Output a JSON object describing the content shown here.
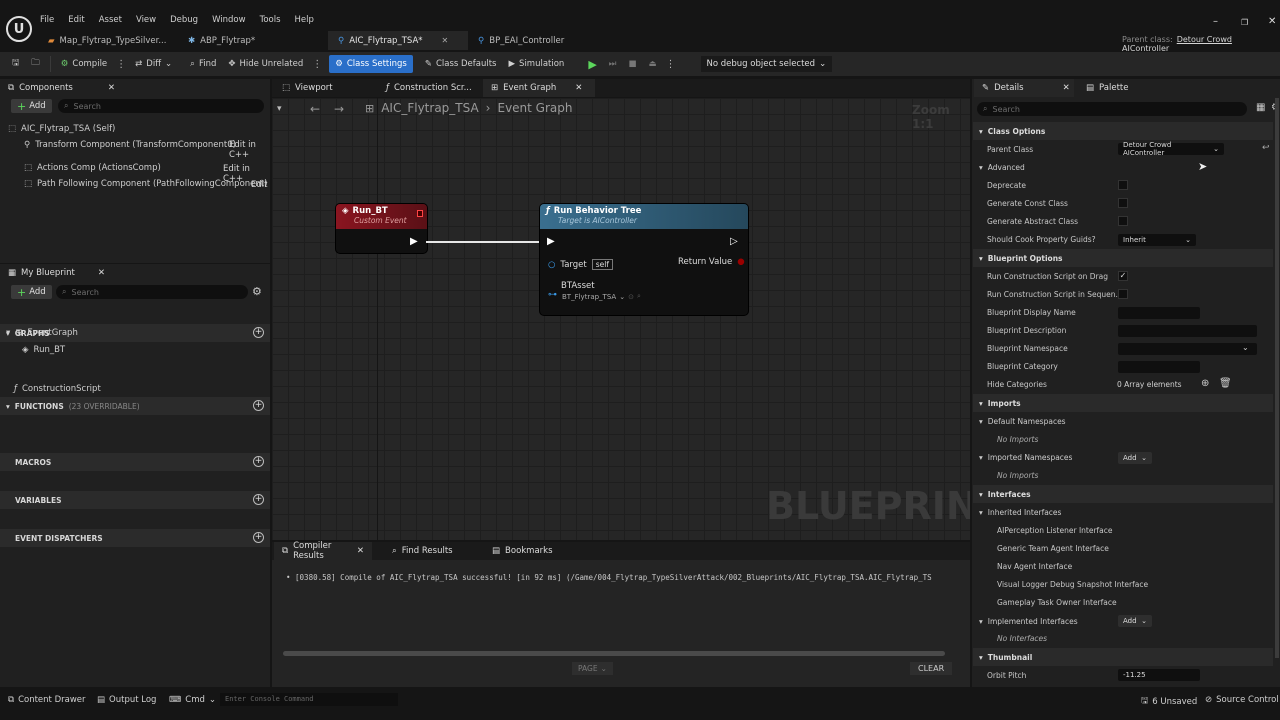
{
  "menu": [
    "File",
    "Edit",
    "Asset",
    "View",
    "Debug",
    "Window",
    "Tools",
    "Help"
  ],
  "doc_tabs": [
    {
      "label": "Map_Flytrap_TypeSilver..."
    },
    {
      "label": "ABP_Flytrap*"
    },
    {
      "label": "AIC_Flytrap_TSA*"
    },
    {
      "label": "BP_EAI_Controller"
    }
  ],
  "parent_class": {
    "label": "Parent class:",
    "value": "Detour Crowd AIController"
  },
  "toolbar": {
    "compile": "Compile",
    "diff": "Diff",
    "find": "Find",
    "hide_unrelated": "Hide Unrelated",
    "class_settings": "Class Settings",
    "class_defaults": "Class Defaults",
    "simulation": "Simulation",
    "debug_object": "No debug object selected"
  },
  "components": {
    "tab": "Components",
    "add": "Add",
    "search_placeholder": "Search",
    "root": "AIC_Flytrap_TSA (Self)",
    "items": [
      {
        "label": "Transform Component (TransformComponent0)",
        "edit": "Edit in C++"
      },
      {
        "label": "Actions Comp (ActionsComp)",
        "edit": "Edit in C++"
      },
      {
        "label": "Path Following Component (PathFollowingComponent)",
        "edit": "Edit"
      }
    ]
  },
  "my_blueprint": {
    "tab": "My Blueprint",
    "add": "Add",
    "search_placeholder": "Search",
    "graphs": "GRAPHS",
    "eventgraph": "EventGraph",
    "run_bt": "Run_BT",
    "functions": "FUNCTIONS",
    "functions_note": "(23 OVERRIDABLE)",
    "construction": "ConstructionScript",
    "macros": "MACROS",
    "variables": "VARIABLES",
    "dispatchers": "EVENT DISPATCHERS"
  },
  "editor_tabs": {
    "viewport": "Viewport",
    "construction": "Construction Scr...",
    "event_graph": "Event Graph"
  },
  "graph": {
    "breadcrumb_bp": "AIC_Flytrap_TSA",
    "breadcrumb_sep": "›",
    "breadcrumb_graph": "Event Graph",
    "zoom": "Zoom 1:1",
    "watermark": "BLUEPRINT",
    "event_node": {
      "title": "Run_BT",
      "subtitle": "Custom Event"
    },
    "func_node": {
      "title": "Run Behavior Tree",
      "subtitle": "Target is AIController",
      "target": "Target",
      "self": "self",
      "return_value": "Return Value",
      "btasset": "BTAsset",
      "btasset_value": "BT_Flytrap_TSA"
    }
  },
  "bottom": {
    "tabs": [
      "Compiler Results",
      "Find Results",
      "Bookmarks"
    ],
    "log": "[0380.58] Compile of AIC_Flytrap_TSA successful! [in 92 ms] (/Game/004_Flytrap_TypeSilverAttack/002_Blueprints/AIC_Flytrap_TSA.AIC_Flytrap_TS",
    "page": "PAGE",
    "clear": "CLEAR"
  },
  "details": {
    "tab": "Details",
    "palette": "Palette",
    "search_placeholder": "Search",
    "class_options": "Class Options",
    "parent_class": "Parent Class",
    "parent_class_value": "Detour Crowd AIController",
    "advanced": "Advanced",
    "deprecate": "Deprecate",
    "gen_const": "Generate Const Class",
    "gen_abstract": "Generate Abstract Class",
    "cook_guids": "Should Cook Property Guids?",
    "cook_guids_value": "Inherit",
    "bp_options": "Blueprint Options",
    "run_cs_drag": "Run Construction Script on Drag",
    "run_cs_seq": "Run Construction Script in Sequen...",
    "bp_display_name": "Blueprint Display Name",
    "bp_description": "Blueprint Description",
    "bp_namespace": "Blueprint Namespace",
    "bp_category": "Blueprint Category",
    "hide_categories": "Hide Categories",
    "array_elements": "0 Array elements",
    "imports": "Imports",
    "default_ns": "Default Namespaces",
    "no_imports": "No Imports",
    "imported_ns": "Imported Namespaces",
    "add": "Add",
    "interfaces": "Interfaces",
    "inherited": "Inherited Interfaces",
    "inherited_list": [
      "AIPerception Listener Interface",
      "Generic Team Agent Interface",
      "Nav Agent Interface",
      "Visual Logger Debug Snapshot Interface",
      "Gameplay Task Owner Interface"
    ],
    "implemented": "Implemented Interfaces",
    "no_interfaces": "No Interfaces",
    "thumbnail": "Thumbnail",
    "orbit_pitch": "Orbit Pitch",
    "orbit_pitch_value": "-11.25"
  },
  "status": {
    "content_drawer": "Content Drawer",
    "output_log": "Output Log",
    "cmd": "Cmd",
    "console_placeholder": "Enter Console Command",
    "unsaved": "6 Unsaved",
    "source_control": "Source Control"
  }
}
